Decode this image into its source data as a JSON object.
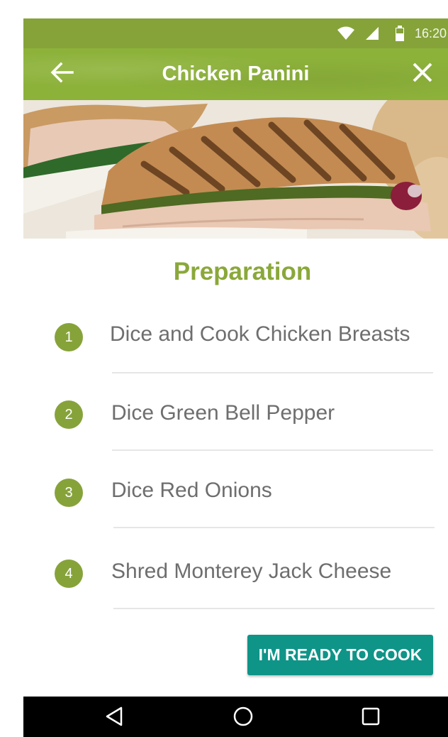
{
  "status_bar": {
    "time": "16:20",
    "icons": [
      "wifi-icon",
      "cell-signal-icon",
      "battery-icon"
    ],
    "color": "#86a33a"
  },
  "app_bar": {
    "title": "Chicken Panini",
    "back_icon": "arrow-left-icon",
    "close_icon": "close-icon",
    "color": "#8db23a"
  },
  "hero": {
    "image": "panini-sandwich-photo"
  },
  "preparation": {
    "title": "Preparation",
    "accent": "#8aa83a",
    "steps": [
      {
        "number": "1",
        "text": "Dice and Cook Chicken Breasts"
      },
      {
        "number": "2",
        "text": "Dice Green Bell Pepper"
      },
      {
        "number": "3",
        "text": "Dice Red Onions"
      },
      {
        "number": "4",
        "text": "Shred Monterey Jack Cheese"
      }
    ]
  },
  "ready_button": {
    "label": "I'M READY TO COOK",
    "color": "#0f9488"
  },
  "nav_bar": {
    "icons": [
      "nav-back-icon",
      "nav-home-icon",
      "nav-recents-icon"
    ]
  }
}
